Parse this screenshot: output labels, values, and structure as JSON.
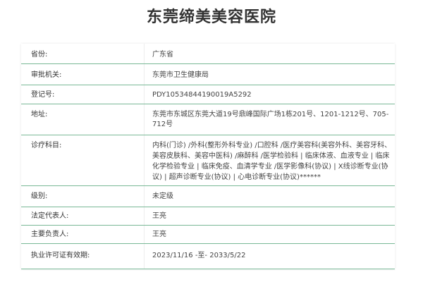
{
  "page": {
    "title": "东莞缔美美容医院"
  },
  "details": {
    "province": {
      "label": "省份:",
      "value": "广东省"
    },
    "authority": {
      "label": "审批机关:",
      "value": "东莞市卫生健康局"
    },
    "reg_no": {
      "label": "登记号:",
      "value": "PDY10534844190019A5292"
    },
    "address": {
      "label": "地址:",
      "value": "东莞市东城区东莞大道19号鼎峰国际广场1栋201号、1201-1212号、705-712号"
    },
    "departments": {
      "label": "诊疗科目:",
      "value": "内科(门诊) /外科(整形外科专业) /口腔科 /医疗美容科(美容外科、美容牙科、美容皮肤科、美容中医科) /麻醉科 /医学检验科 | 临床体液、血液专业 | 临床化学检验专业 | 临床免疫、血清学专业 /医学影像科(协议) | X线诊断专业(协议) | 超声诊断专业(协议) | 心电诊断专业(协议)******"
    },
    "grade": {
      "label": "级别:",
      "value": "未定级"
    },
    "legal_rep": {
      "label": "法定代表人:",
      "value": "王亮"
    },
    "principal": {
      "label": "主要负责人:",
      "value": "王亮"
    },
    "license_period": {
      "label": "执业许可证有效期:",
      "value": "2023/11/16 -至- 2033/5/22"
    }
  },
  "colors": {
    "row_divider": "#79b896",
    "text": "#333333"
  }
}
